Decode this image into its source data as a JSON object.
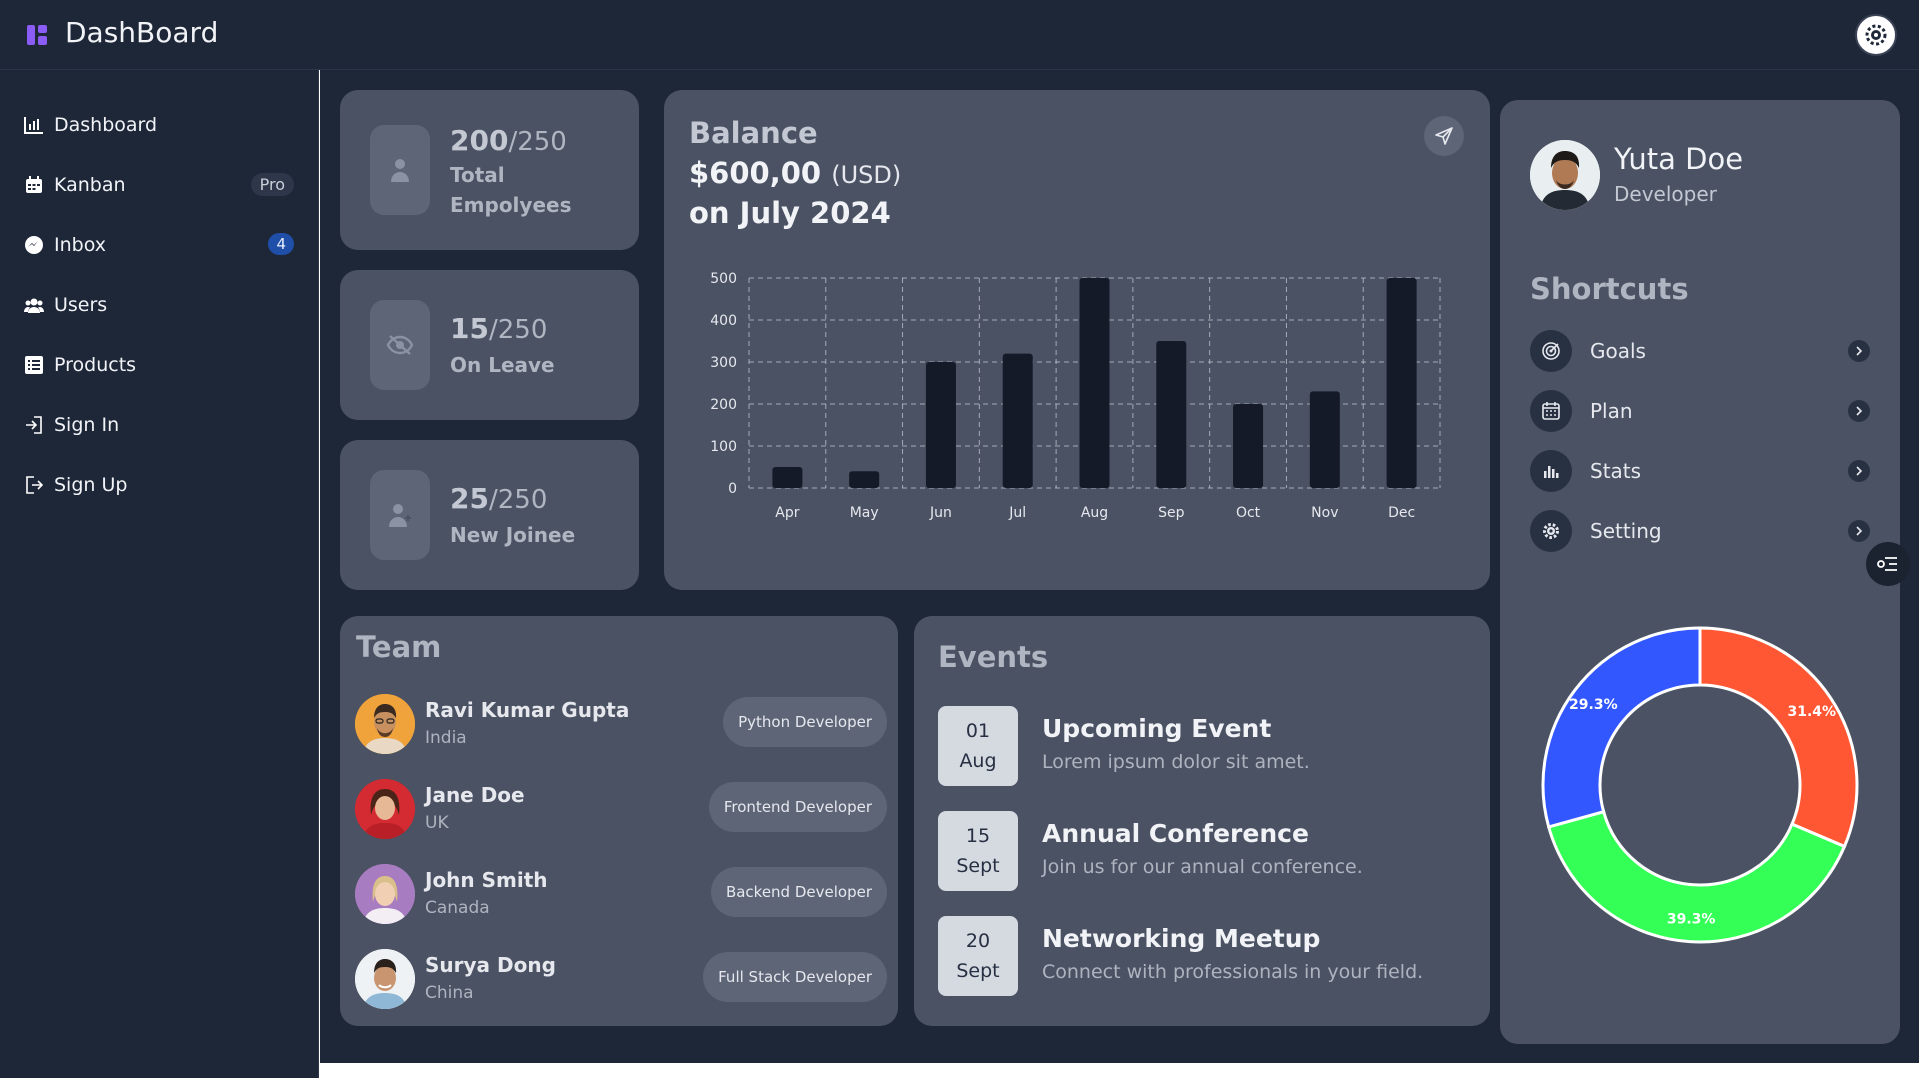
{
  "app": {
    "title": "DashBoard"
  },
  "sidebar": {
    "items": [
      {
        "label": "Dashboard",
        "icon": "bar-chart-icon"
      },
      {
        "label": "Kanban",
        "icon": "calendar-icon",
        "badge": "Pro"
      },
      {
        "label": "Inbox",
        "icon": "messenger-icon",
        "badge": "4"
      },
      {
        "label": "Users",
        "icon": "users-icon"
      },
      {
        "label": "Products",
        "icon": "list-icon"
      },
      {
        "label": "Sign In",
        "icon": "sign-in-icon"
      },
      {
        "label": "Sign Up",
        "icon": "sign-up-icon"
      }
    ]
  },
  "stats": [
    {
      "value": "200",
      "total": "/250",
      "label": "Total Empolyees",
      "icon": "user-icon"
    },
    {
      "value": "15",
      "total": "/250",
      "label": "On Leave",
      "icon": "eye-off-icon"
    },
    {
      "value": "25",
      "total": "/250",
      "label": "New Joinee",
      "icon": "user-plus-icon"
    }
  ],
  "balance": {
    "title": "Balance",
    "amount": "$600,00",
    "currency": "(USD)",
    "date": "on July 2024"
  },
  "chart_data": [
    {
      "type": "bar",
      "categories": [
        "Apr",
        "May",
        "Jun",
        "Jul",
        "Aug",
        "Sep",
        "Oct",
        "Nov",
        "Dec"
      ],
      "values": [
        50,
        40,
        300,
        320,
        500,
        350,
        200,
        230,
        500
      ],
      "yticks": [
        0,
        100,
        200,
        300,
        400,
        500
      ],
      "ylim": [
        0,
        500
      ],
      "grid": true,
      "color": "#141a27"
    },
    {
      "type": "pie",
      "donut": true,
      "labels": [
        "31.4%",
        "39.3%",
        "29.3%"
      ],
      "values": [
        31.4,
        39.3,
        29.3
      ],
      "colors": [
        "#ff5733",
        "#33ff57",
        "#3357ff"
      ]
    }
  ],
  "profile": {
    "name": "Yuta Doe",
    "role": "Developer"
  },
  "shortcuts": {
    "title": "Shortcuts",
    "items": [
      {
        "label": "Goals",
        "icon": "target-icon"
      },
      {
        "label": "Plan",
        "icon": "calendar-icon"
      },
      {
        "label": "Stats",
        "icon": "stats-icon"
      },
      {
        "label": "Setting",
        "icon": "gear-icon"
      }
    ]
  },
  "team": {
    "title": "Team",
    "members": [
      {
        "name": "Ravi Kumar Gupta",
        "country": "India",
        "role": "Python Developer"
      },
      {
        "name": "Jane Doe",
        "country": "UK",
        "role": "Frontend Developer"
      },
      {
        "name": "John Smith",
        "country": "Canada",
        "role": "Backend Developer"
      },
      {
        "name": "Surya Dong",
        "country": "China",
        "role": "Full Stack Developer"
      }
    ]
  },
  "events": {
    "title": "Events",
    "items": [
      {
        "day": "01",
        "month": "Aug",
        "title": "Upcoming Event",
        "desc": "Lorem ipsum dolor sit amet."
      },
      {
        "day": "15",
        "month": "Sept",
        "title": "Annual Conference",
        "desc": "Join us for our annual conference."
      },
      {
        "day": "20",
        "month": "Sept",
        "title": "Networking Meetup",
        "desc": "Connect with professionals in your field."
      }
    ]
  }
}
